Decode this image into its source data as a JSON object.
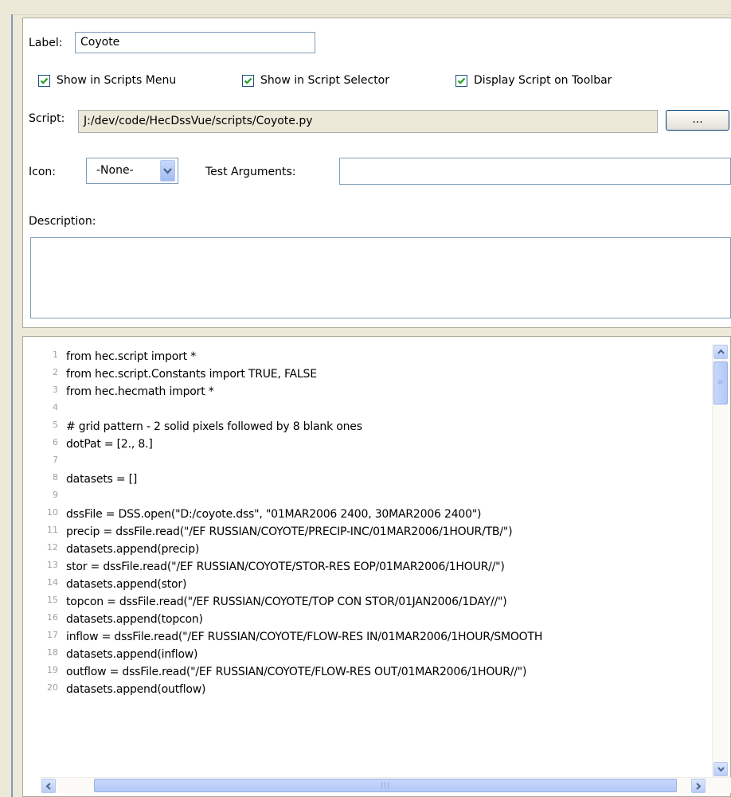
{
  "form": {
    "label_caption": "Label:",
    "label_value": "Coyote",
    "checkboxes": [
      {
        "label": "Show in Scripts Menu",
        "checked": true
      },
      {
        "label": "Show in Script Selector",
        "checked": true
      },
      {
        "label": "Display Script on Toolbar",
        "checked": true
      }
    ],
    "script_caption": "Script:",
    "script_path": "J:/dev/code/HecDssVue/scripts/Coyote.py",
    "browse_label": "...",
    "icon_caption": "Icon:",
    "icon_value": "-None-",
    "test_args_caption": "Test Arguments:",
    "test_args_value": "",
    "description_caption": "Description:",
    "description_value": ""
  },
  "editor": {
    "lines": [
      {
        "n": "1",
        "text": "from hec.script import *"
      },
      {
        "n": "2",
        "text": "from hec.script.Constants import TRUE, FALSE"
      },
      {
        "n": "3",
        "text": "from hec.hecmath import *"
      },
      {
        "n": "4",
        "text": ""
      },
      {
        "n": "5",
        "text": "#  grid pattern - 2 solid pixels followed by 8 blank ones"
      },
      {
        "n": "6",
        "text": "dotPat = [2., 8.]"
      },
      {
        "n": "7",
        "text": ""
      },
      {
        "n": "8",
        "text": "datasets = []"
      },
      {
        "n": "9",
        "text": ""
      },
      {
        "n": "10",
        "text": "dssFile = DSS.open(\"D:/coyote.dss\", \"01MAR2006 2400, 30MAR2006 2400\")"
      },
      {
        "n": "11",
        "text": "precip = dssFile.read(\"/EF RUSSIAN/COYOTE/PRECIP-INC/01MAR2006/1HOUR/TB/\")"
      },
      {
        "n": "12",
        "text": "datasets.append(precip)"
      },
      {
        "n": "13",
        "text": "stor = dssFile.read(\"/EF RUSSIAN/COYOTE/STOR-RES EOP/01MAR2006/1HOUR//\")"
      },
      {
        "n": "14",
        "text": "datasets.append(stor)"
      },
      {
        "n": "15",
        "text": "topcon = dssFile.read(\"/EF RUSSIAN/COYOTE/TOP CON STOR/01JAN2006/1DAY//\")"
      },
      {
        "n": "16",
        "text": "datasets.append(topcon)"
      },
      {
        "n": "17",
        "text": "inflow = dssFile.read(\"/EF RUSSIAN/COYOTE/FLOW-RES IN/01MAR2006/1HOUR/SMOOTH"
      },
      {
        "n": "18",
        "text": "datasets.append(inflow)"
      },
      {
        "n": "19",
        "text": "outflow = dssFile.read(\"/EF RUSSIAN/COYOTE/FLOW-RES OUT/01MAR2006/1HOUR//\")"
      },
      {
        "n": "20",
        "text": "datasets.append(outflow)"
      }
    ]
  },
  "icons": {
    "check": "check-icon",
    "combo_arrow": "chevron-down-icon",
    "scroll_up": "arrow-up-icon",
    "scroll_down": "arrow-down-icon",
    "scroll_left": "arrow-left-icon",
    "scroll_right": "arrow-right-icon"
  },
  "colors": {
    "check": "#21a121",
    "combo_arrow": "#4d6185"
  }
}
